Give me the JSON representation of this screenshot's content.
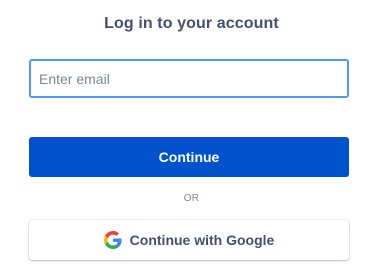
{
  "login": {
    "title": "Log in to your account",
    "email_placeholder": "Enter email",
    "email_value": "",
    "continue_label": "Continue",
    "divider_label": "OR",
    "google_label": "Continue with Google",
    "google_icon": "google-g-icon"
  },
  "colors": {
    "primary": "#0052cc",
    "focus_border": "#4c9aff",
    "title_text": "#42526e",
    "muted_text": "#7a869a"
  }
}
